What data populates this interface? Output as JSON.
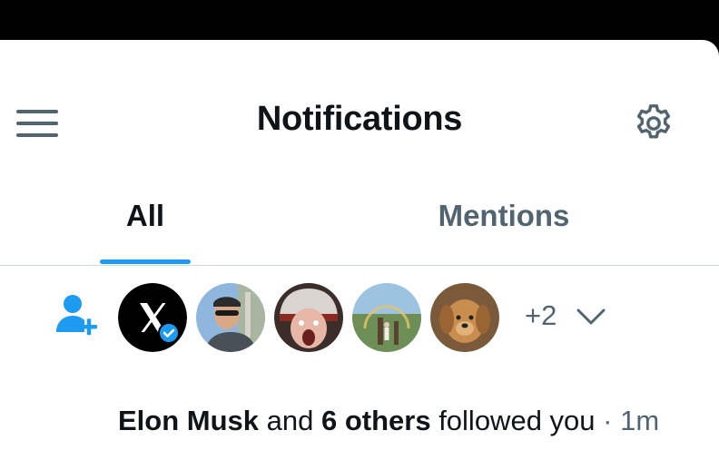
{
  "header": {
    "title": "Notifications",
    "menu_icon": "hamburger-menu-icon",
    "settings_icon": "gear-icon"
  },
  "tabs": [
    {
      "label": "All",
      "active": true
    },
    {
      "label": "Mentions",
      "active": false
    }
  ],
  "notification": {
    "type_icon": "follow-person-icon",
    "avatars": [
      {
        "name": "X logo avatar",
        "verified": true
      },
      {
        "name": "man with sunglasses avatar"
      },
      {
        "name": "person with helmet screaming avatar"
      },
      {
        "name": "person with rainbow avatar"
      },
      {
        "name": "puppy avatar"
      }
    ],
    "more_count": "+2",
    "actor": "Elon Musk",
    "connector": " and ",
    "others": "6 others",
    "action": " followed you",
    "separator": " · ",
    "time": "1m"
  },
  "colors": {
    "accent": "#1d9bf0",
    "text_primary": "#0f1419",
    "text_secondary": "#536471",
    "divider": "#cfd9de"
  }
}
